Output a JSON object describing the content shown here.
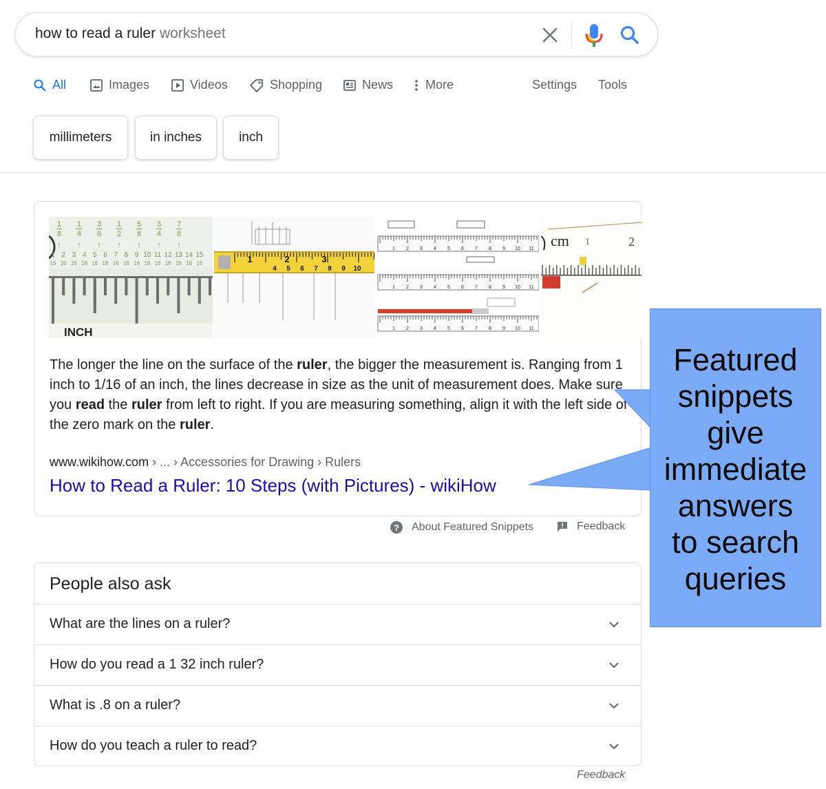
{
  "search": {
    "query_typed": "how to read a ruler",
    "query_suggestion": " worksheet",
    "icons": [
      "close-icon",
      "microphone-icon",
      "search-icon"
    ]
  },
  "tabs": [
    {
      "label": "All",
      "icon": "search-icon",
      "active": true
    },
    {
      "label": "Images",
      "icon": "image-icon"
    },
    {
      "label": "Videos",
      "icon": "play-icon"
    },
    {
      "label": "Shopping",
      "icon": "tag-icon"
    },
    {
      "label": "News",
      "icon": "newspaper-icon"
    },
    {
      "label": "More",
      "icon": "more-vert-icon"
    },
    {
      "label": "Settings"
    },
    {
      "label": "Tools"
    }
  ],
  "chips": [
    "millimeters",
    "in inches",
    "inch"
  ],
  "snippet": {
    "text_parts": [
      {
        "t": "The longer the line on the surface of the ",
        "b": false
      },
      {
        "t": "ruler",
        "b": true
      },
      {
        "t": ", the bigger the measurement is. Ranging from 1 inch to 1/16 of an inch, the lines decrease in size as the unit of measurement does. Make sure you ",
        "b": false
      },
      {
        "t": "read",
        "b": true
      },
      {
        "t": " the ",
        "b": false
      },
      {
        "t": "ruler",
        "b": true
      },
      {
        "t": " from left to right. If you are measuring something, align it with the left side of the zero mark on the ",
        "b": false
      },
      {
        "t": "ruler",
        "b": true
      },
      {
        "t": ".",
        "b": false
      }
    ],
    "breadcrumb_host": "www.wikihow.com",
    "breadcrumb_path": " › ... › Accessories for Drawing › Rulers",
    "link_title": "How to Read a Ruler: 10 Steps (with Pictures) - wikiHow",
    "thumbnails": {
      "inch_ruler": {
        "fractions": [
          "1/8",
          "1/4",
          "3/8",
          "1/2",
          "5/8",
          "3/4",
          "7/8"
        ],
        "sixteenths": [
          "1",
          "2",
          "3",
          "4",
          "5",
          "6",
          "7",
          "8",
          "9",
          "10",
          "11",
          "12",
          "13",
          "14",
          "15"
        ],
        "label": "INCH"
      },
      "tape_ruler": {
        "numbers": [
          "1",
          "2",
          "3",
          "4",
          "5",
          "6",
          "7",
          "8",
          "9",
          "10"
        ]
      },
      "metric_diagram": {
        "numbers": [
          "1",
          "2",
          "3",
          "4",
          "5",
          "6",
          "7",
          "8",
          "9",
          "10",
          "11"
        ]
      },
      "cm_ruler": {
        "label": "cm",
        "numbers": [
          "1",
          "2"
        ]
      }
    }
  },
  "snippet_footer": {
    "about_label": "About Featured Snippets",
    "feedback_label": "Feedback"
  },
  "people_also_ask": {
    "title": "People also ask",
    "questions": [
      "What are the lines on a ruler?",
      "How do you read a 1 32 inch ruler?",
      "What is .8 on a ruler?",
      "How do you teach a ruler to read?"
    ],
    "feedback_label": "Feedback"
  },
  "callout": {
    "lines": [
      "Featured",
      "snippets",
      "give",
      "immediate",
      "answers",
      "to search",
      "queries"
    ],
    "fill": "#7baaf7"
  },
  "colors": {
    "link": "#1a0dab",
    "active_tab": "#1a73e8",
    "secondary_text": "#5f6368"
  }
}
